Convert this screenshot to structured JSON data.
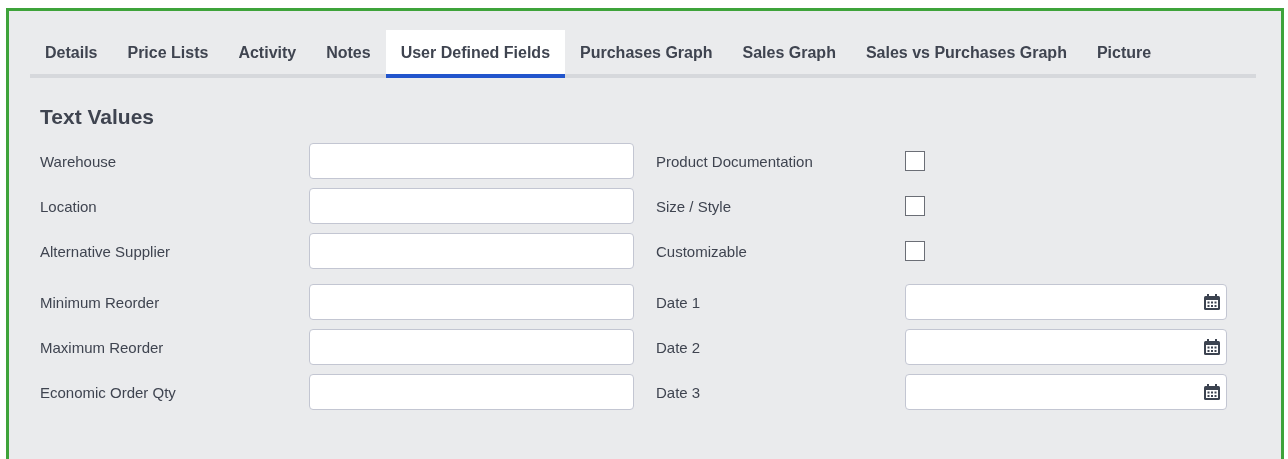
{
  "tabs": [
    {
      "label": "Details",
      "selected": false
    },
    {
      "label": "Price Lists",
      "selected": false
    },
    {
      "label": "Activity",
      "selected": false
    },
    {
      "label": "Notes",
      "selected": false
    },
    {
      "label": "User Defined Fields",
      "selected": true
    },
    {
      "label": "Purchases Graph",
      "selected": false
    },
    {
      "label": "Sales Graph",
      "selected": false
    },
    {
      "label": "Sales vs Purchases Graph",
      "selected": false
    },
    {
      "label": "Picture",
      "selected": false
    }
  ],
  "section_title": "Text Values",
  "rows": [
    {
      "left": {
        "label": "Warehouse",
        "kind": "text"
      },
      "right": {
        "label": "Product Documentation",
        "kind": "checkbox",
        "checked": false
      }
    },
    {
      "left": {
        "label": "Location",
        "kind": "text"
      },
      "right": {
        "label": "Size / Style",
        "kind": "checkbox",
        "checked": false
      }
    },
    {
      "left": {
        "label": "Alternative Supplier",
        "kind": "text"
      },
      "right": {
        "label": "Customizable",
        "kind": "checkbox",
        "checked": false
      }
    },
    {
      "left": {
        "label": "Minimum Reorder",
        "kind": "text"
      },
      "right": {
        "label": "Date 1",
        "kind": "date"
      }
    },
    {
      "left": {
        "label": "Maximum Reorder",
        "kind": "text"
      },
      "right": {
        "label": "Date 2",
        "kind": "date"
      }
    },
    {
      "left": {
        "label": "Economic Order Qty",
        "kind": "text"
      },
      "right": {
        "label": "Date 3",
        "kind": "date"
      }
    }
  ]
}
